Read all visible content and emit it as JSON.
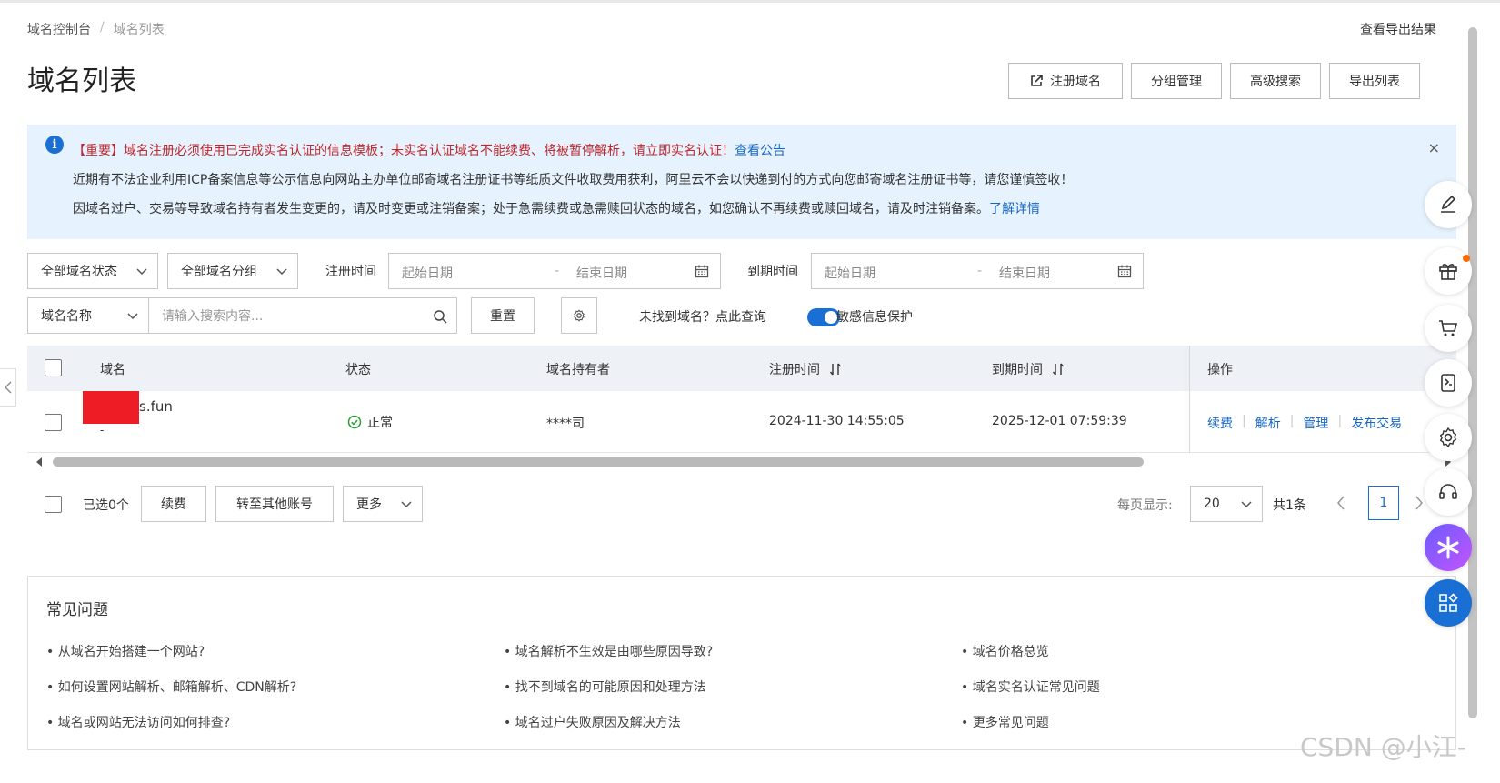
{
  "breadcrumb": {
    "root": "域名控制台",
    "sep": "/",
    "current": "域名列表"
  },
  "header": {
    "export_result": "查看导出结果",
    "title": "域名列表",
    "buttons": {
      "register": "注册域名",
      "group": "分组管理",
      "advanced": "高级搜索",
      "export": "导出列表"
    }
  },
  "notice": {
    "line1": "【重要】域名注册必须使用已完成实名认证的信息模板；未实名认证域名不能续费、将被暂停解析，请立即实名认证！",
    "line1_link": "查看公告",
    "line2": "近期有不法企业利用ICP备案信息等公示信息向网站主办单位邮寄域名注册证书等纸质文件收取费用获利，阿里云不会以快递到付的方式向您邮寄域名注册证书等，请您谨慎签收！",
    "line3": "因域名过户、交易等导致域名持有者发生变更的，请及时变更或注销备案；处于急需续费或急需赎回状态的域名，如您确认不再续费或赎回域名，请及时注销备案。",
    "line3_link": "了解详情",
    "close": "×"
  },
  "filters": {
    "status": "全部域名状态",
    "group": "全部域名分组",
    "reg_time_label": "注册时间",
    "exp_time_label": "到期时间",
    "start_placeholder": "起始日期",
    "end_placeholder": "结束日期",
    "dash": "-",
    "search_type": "域名名称",
    "search_placeholder": "请输入搜索内容...",
    "reset": "重置",
    "not_found_link": "未找到域名？点此查询",
    "privacy_label": "敏感信息保护"
  },
  "table": {
    "headers": {
      "domain": "域名",
      "status": "状态",
      "holder": "域名持有者",
      "reg_time": "注册时间",
      "exp_time": "到期时间",
      "actions": "操作"
    },
    "rows": [
      {
        "domain": "s.fun",
        "domain_sub": "-",
        "status": "正常",
        "holder": "****司",
        "reg_time": "2024-11-30 14:55:05",
        "exp_time": "2025-12-01 07:59:39",
        "actions": [
          "续费",
          "解析",
          "管理",
          "发布交易"
        ]
      }
    ]
  },
  "bulk": {
    "selected": "已选0个",
    "renew": "续费",
    "transfer": "转至其他账号",
    "more": "更多"
  },
  "pager": {
    "per_page_label": "每页显示:",
    "per_page": "20",
    "total": "共1条",
    "current": "1"
  },
  "faq": {
    "title": "常见问题",
    "items": [
      "从域名开始搭建一个网站?",
      "域名解析不生效是由哪些原因导致?",
      "域名价格总览",
      "如何设置网站解析、邮箱解析、CDN解析?",
      "找不到域名的可能原因和处理方法",
      "域名实名认证常见问题",
      "域名或网站无法访问如何排查?",
      "域名过户失败原因及解决方法",
      "更多常见问题"
    ]
  },
  "watermark": "CSDN @小江-",
  "colors": {
    "primary": "#1a6fd4",
    "notice_bg": "#e6f2fd",
    "warning_text": "#c0272d",
    "success": "#2a9d3b",
    "redaction": "#ee1c25"
  },
  "icons": [
    "external-link-icon",
    "info-icon",
    "close-icon",
    "chevron-down-icon",
    "calendar-icon",
    "search-icon",
    "settings-icon",
    "sort-icon",
    "check-circle-icon",
    "edit-icon",
    "gift-icon",
    "cart-icon",
    "book-icon",
    "gear-icon",
    "headset-icon",
    "ai-assistant-icon",
    "apps-icon"
  ]
}
